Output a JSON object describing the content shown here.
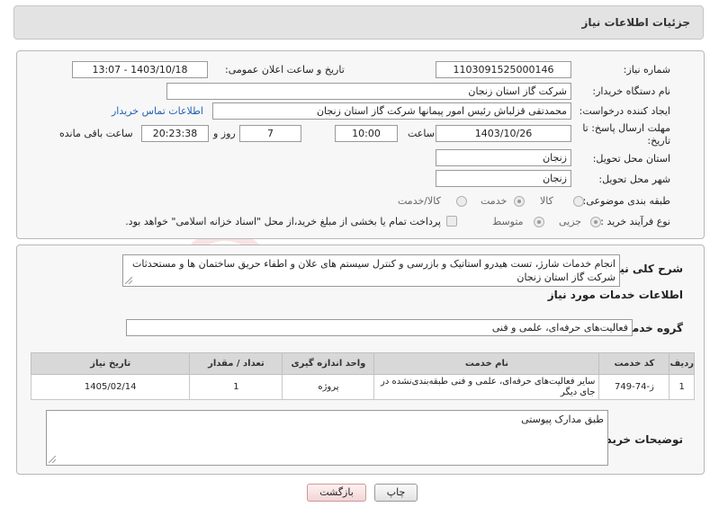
{
  "header": {
    "title": "جزئیات اطلاعات نیاز"
  },
  "form": {
    "need_number_label": "شماره نیاز:",
    "need_number": "1103091525000146",
    "announce_label": "تاریخ و ساعت اعلان عمومی:",
    "announce_value": "1403/10/18 - 13:07",
    "buyer_org_label": "نام دستگاه خریدار:",
    "buyer_org": "شرکت گاز استان زنجان",
    "creator_label": "ایجاد کننده درخواست:",
    "creator": "محمدتقی قزلباش رئیس امور پیمانها شرکت گاز استان زنجان",
    "contact_link": "اطلاعات تماس خریدار",
    "deadline_label_1": "مهلت ارسال پاسخ: تا",
    "deadline_label_2": "تاریخ:",
    "deadline_date": "1403/10/26",
    "time_label": "ساعت",
    "deadline_time": "10:00",
    "days_value": "7",
    "days_label": "روز و",
    "remaining_value": "20:23:38",
    "remaining_label": "ساعت باقی مانده",
    "province_label": "استان محل تحویل:",
    "province": "زنجان",
    "city_label": "شهر محل تحویل:",
    "city": "زنجان",
    "category_label": "طبقه بندی موضوعی:",
    "category_options": [
      "کالا",
      "خدمت",
      "کالا/خدمت"
    ],
    "category_selected": "خدمت",
    "process_label": "نوع فرآیند خرید :",
    "process_options": [
      "جزیی",
      "متوسط"
    ],
    "process_selected": "جزیی",
    "payment_note": "پرداخت تمام یا بخشی از مبلغ خرید،از محل \"اسناد خزانه اسلامی\" خواهد بود."
  },
  "summary": {
    "label": "شرح کلی نیاز:",
    "text": "انجام خدمات شارژ، تست هیدرو استاتیک و بازرسی و کنترل سیستم های علان و اطفاء حریق ساختمان ها و مستحدثات شرکت گاز استان زنجان"
  },
  "services": {
    "section_title": "اطلاعات خدمات مورد نیاز",
    "group_label": "گروه خدمت:",
    "group_value": "فعالیت‌های حرفه‌ای، علمی و فنی",
    "columns": [
      "ردیف",
      "کد خدمت",
      "نام خدمت",
      "واحد اندازه گیری",
      "تعداد / مقدار",
      "تاریخ نیاز"
    ],
    "rows": [
      [
        "1",
        "ز-74-749",
        "سایر فعالیت‌های حرفه‌ای، علمی و فنی طبقه‌بندی‌نشده در جای دیگر",
        "پروژه",
        "1",
        "1405/02/14"
      ]
    ]
  },
  "buyer_notes": {
    "label": "توضیحات خریدار:",
    "text": "طبق مدارک پیوستی"
  },
  "buttons": {
    "print": "چاپ",
    "back": "بازگشت"
  },
  "colors": {
    "link": "#1e63b5",
    "header_bg": "#e3e3e3",
    "back_button": "#f2d6d6"
  }
}
